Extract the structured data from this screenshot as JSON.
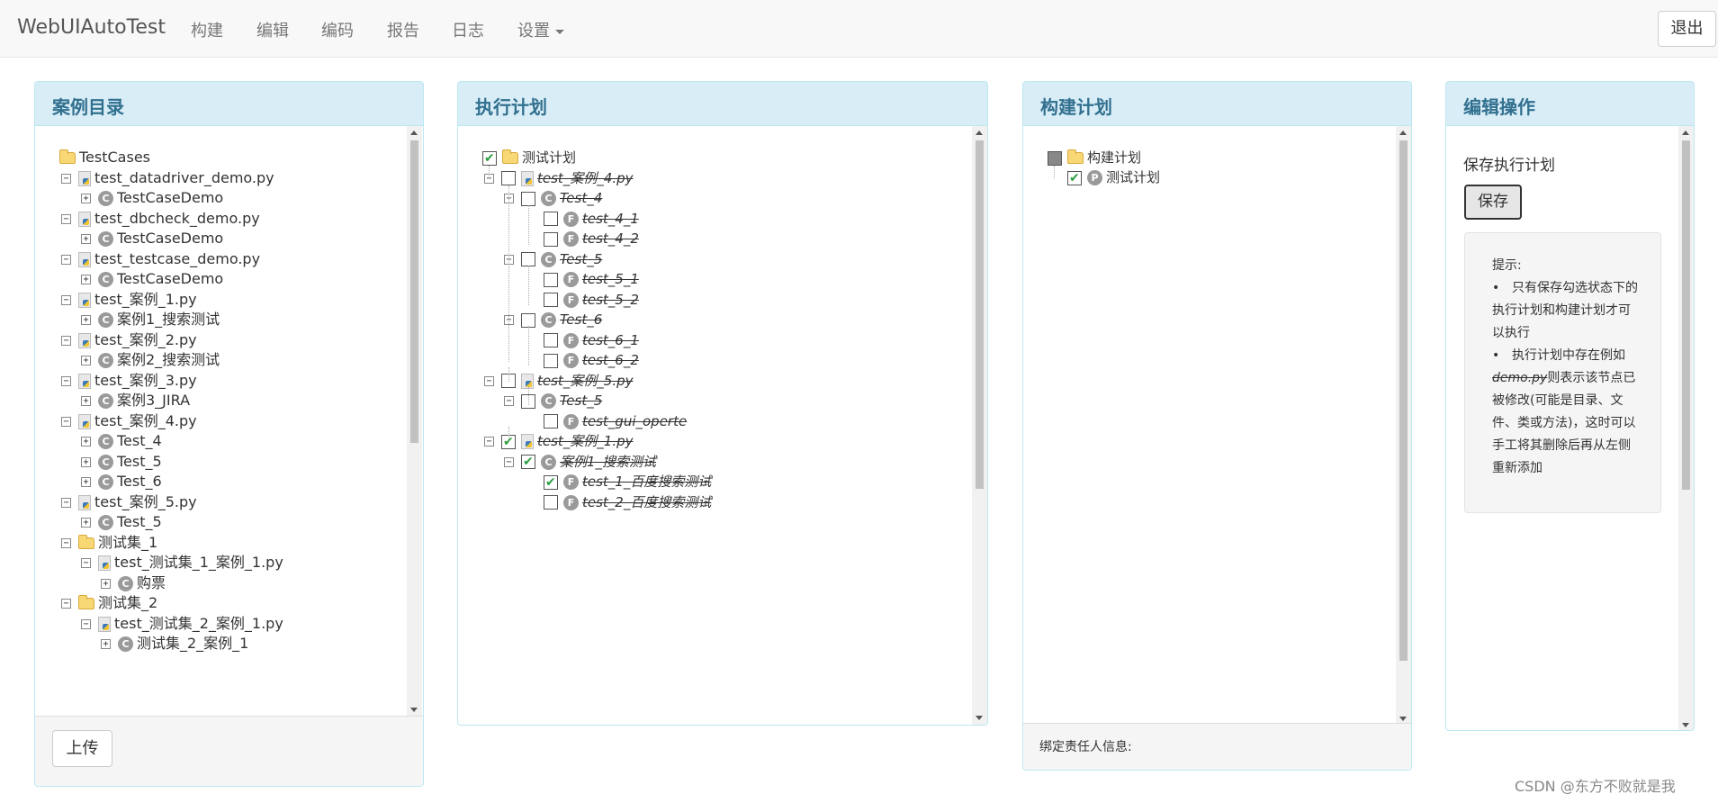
{
  "navbar": {
    "brand": "WebUIAutoTest",
    "items": [
      "构建",
      "编辑",
      "编码",
      "报告",
      "日志"
    ],
    "settings": "设置",
    "logout": "退出"
  },
  "cases_panel": {
    "title": "案例目录",
    "upload": "上传",
    "tree": [
      {
        "label": "TestCases",
        "icon": "folder-icon",
        "exp": ""
      },
      {
        "label": "test_datadriver_demo.py",
        "icon": "python-file-icon",
        "exp": "⊟"
      },
      {
        "label": "TestCaseDemo",
        "icon": "class-icon",
        "exp": "⊞"
      },
      {
        "label": "test_dbcheck_demo.py",
        "icon": "python-file-icon",
        "exp": "⊟"
      },
      {
        "label": "TestCaseDemo",
        "icon": "class-icon",
        "exp": "⊞"
      },
      {
        "label": "test_testcase_demo.py",
        "icon": "python-file-icon",
        "exp": "⊟"
      },
      {
        "label": "TestCaseDemo",
        "icon": "class-icon",
        "exp": "⊞"
      },
      {
        "label": "test_案例_1.py",
        "icon": "python-file-icon",
        "exp": "⊟"
      },
      {
        "label": "案例1_搜索测试",
        "icon": "class-icon",
        "exp": "⊞"
      },
      {
        "label": "test_案例_2.py",
        "icon": "python-file-icon",
        "exp": "⊟"
      },
      {
        "label": "案例2_搜索测试",
        "icon": "class-icon",
        "exp": "⊞"
      },
      {
        "label": "test_案例_3.py",
        "icon": "python-file-icon",
        "exp": "⊟"
      },
      {
        "label": "案例3_JIRA",
        "icon": "class-icon",
        "exp": "⊞"
      },
      {
        "label": "test_案例_4.py",
        "icon": "python-file-icon",
        "exp": "⊟"
      },
      {
        "label": "Test_4",
        "icon": "class-icon",
        "exp": "⊞"
      },
      {
        "label": "Test_5",
        "icon": "class-icon",
        "exp": "⊞"
      },
      {
        "label": "Test_6",
        "icon": "class-icon",
        "exp": "⊞"
      },
      {
        "label": "test_案例_5.py",
        "icon": "python-file-icon",
        "exp": "⊟"
      },
      {
        "label": "Test_5",
        "icon": "class-icon",
        "exp": "⊞"
      },
      {
        "label": "测试集_1",
        "icon": "folder-icon",
        "exp": "⊟"
      },
      {
        "label": "test_测试集_1_案例_1.py",
        "icon": "python-file-icon",
        "exp": "⊟"
      },
      {
        "label": "购票",
        "icon": "class-icon",
        "exp": "⊞"
      },
      {
        "label": "测试集_2",
        "icon": "folder-icon",
        "exp": "⊟"
      },
      {
        "label": "test_测试集_2_案例_1.py",
        "icon": "python-file-icon",
        "exp": "⊟"
      },
      {
        "label": "测试集_2_案例_1",
        "icon": "class-icon",
        "exp": "⊞"
      }
    ]
  },
  "exec_panel": {
    "title": "执行计划",
    "tree": [
      {
        "label": "测试计划",
        "icon": "folder-icon",
        "exp": "",
        "checked": true,
        "strike": false
      },
      {
        "label": "test_案例_4.py",
        "icon": "python-file-icon",
        "exp": "⊟",
        "checked": false,
        "strike": true
      },
      {
        "label": "Test_4",
        "icon": "class-icon",
        "exp": "⊟",
        "checked": false,
        "strike": true
      },
      {
        "label": "test_4_1",
        "icon": "function-icon",
        "exp": "",
        "checked": false,
        "strike": true
      },
      {
        "label": "test_4_2",
        "icon": "function-icon",
        "exp": "",
        "checked": false,
        "strike": true
      },
      {
        "label": "Test_5",
        "icon": "class-icon",
        "exp": "⊟",
        "checked": false,
        "strike": true
      },
      {
        "label": "test_5_1",
        "icon": "function-icon",
        "exp": "",
        "checked": false,
        "strike": true
      },
      {
        "label": "test_5_2",
        "icon": "function-icon",
        "exp": "",
        "checked": false,
        "strike": true
      },
      {
        "label": "Test_6",
        "icon": "class-icon",
        "exp": "⊟",
        "checked": false,
        "strike": true
      },
      {
        "label": "test_6_1",
        "icon": "function-icon",
        "exp": "",
        "checked": false,
        "strike": true
      },
      {
        "label": "test_6_2",
        "icon": "function-icon",
        "exp": "",
        "checked": false,
        "strike": true
      },
      {
        "label": "test_案例_5.py",
        "icon": "python-file-icon",
        "exp": "⊟",
        "checked": false,
        "strike": true
      },
      {
        "label": "Test_5",
        "icon": "class-icon",
        "exp": "⊟",
        "checked": false,
        "strike": true
      },
      {
        "label": "test_gui_operte",
        "icon": "function-icon",
        "exp": "",
        "checked": false,
        "strike": true
      },
      {
        "label": "test_案例_1.py",
        "icon": "python-file-icon",
        "exp": "⊟",
        "checked": true,
        "strike": true
      },
      {
        "label": "案例1_搜索测试",
        "icon": "class-icon",
        "exp": "⊟",
        "checked": true,
        "strike": true
      },
      {
        "label": "test_1_百度搜索测试",
        "icon": "function-icon",
        "exp": "",
        "checked": true,
        "strike": true
      },
      {
        "label": "test_2_百度搜索测试",
        "icon": "function-icon",
        "exp": "",
        "checked": false,
        "strike": true
      }
    ]
  },
  "build_panel": {
    "title": "构建计划",
    "root": "构建计划",
    "child": "测试计划",
    "footer": "绑定责任人信息:"
  },
  "edit_panel": {
    "title": "编辑操作",
    "save_label": "保存执行计划",
    "save_button": "保存",
    "tip_title": "提示:",
    "tip1": "只有保存勾选状态下的执行计划和构建计划才可以执行",
    "tip2_pre": "执行计划中存在例如",
    "tip2_strike": "demo.py",
    "tip2_post": "则表示该节点已被修改(可能是目录、文件、类或方法)，这时可以手工将其删除后再从左侧重新添加"
  },
  "watermark": "CSDN @东方不败就是我"
}
